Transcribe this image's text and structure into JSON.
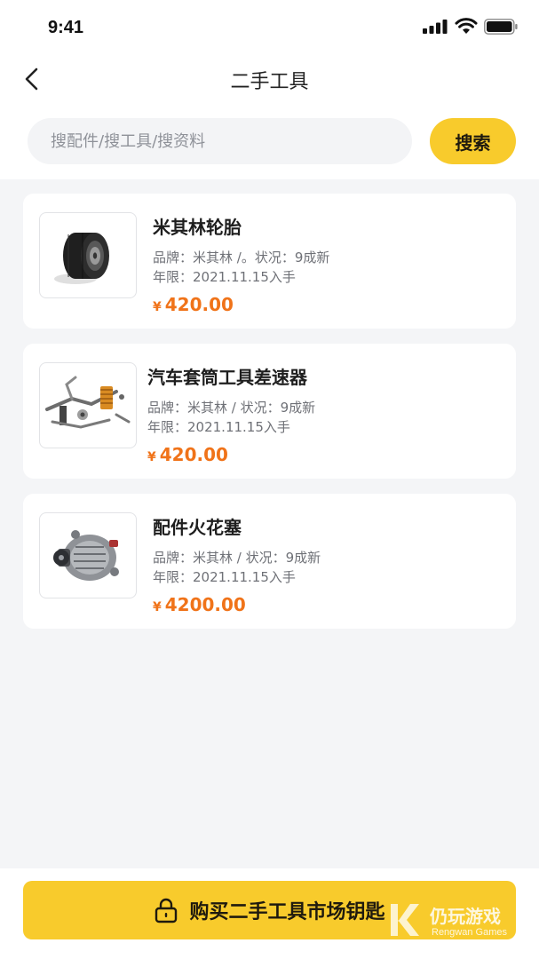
{
  "status_bar": {
    "time": "9:41",
    "icons": [
      "signal-icon",
      "wifi-icon",
      "battery-icon"
    ]
  },
  "nav": {
    "back_icon": "chevron-left-icon",
    "title": "二手工具"
  },
  "search": {
    "placeholder": "搜配件/搜工具/搜资料",
    "value": "",
    "button_label": "搜索"
  },
  "products": [
    {
      "name": "米其林轮胎",
      "brand_line": "品牌：米其林 /。状况：9成新",
      "year_line": "年限：2021.11.15入手",
      "currency": "¥",
      "price": "420.00",
      "image": "tire-image"
    },
    {
      "name": "汽车套筒工具差速器",
      "brand_line": "品牌：米其林 / 状况：9成新",
      "year_line": "年限：2021.11.15入手",
      "currency": "¥",
      "price": "420.00",
      "image": "suspension-parts-image"
    },
    {
      "name": "配件火花塞",
      "brand_line": "品牌：米其林 / 状况：9成新",
      "year_line": "年限：2021.11.15入手",
      "currency": "¥",
      "price": "4200.00",
      "image": "alternator-image"
    }
  ],
  "footer": {
    "icon": "lock-icon",
    "button_label": "购买二手工具市场钥匙"
  },
  "watermark": {
    "text": "仍玩游戏",
    "sub": "Rengwan Games"
  },
  "colors": {
    "accent": "#f8cb2c",
    "price": "#f07319",
    "background": "#f4f5f7"
  }
}
